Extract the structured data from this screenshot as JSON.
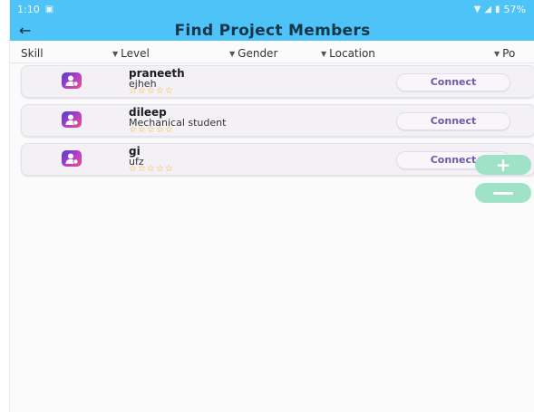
{
  "status_bar": {
    "time": "1:10",
    "battery": "57%"
  },
  "header": {
    "title": "Find Project Members",
    "back_icon": "arrow-left-icon"
  },
  "filters": [
    {
      "label": "Skill",
      "has_caret": false
    },
    {
      "label": "Level",
      "has_caret": true
    },
    {
      "label": "Gender",
      "has_caret": true
    },
    {
      "label": "Location",
      "has_caret": true
    },
    {
      "label": "Po",
      "has_caret": true
    }
  ],
  "members": [
    {
      "name": "praneeth",
      "subtitle": "ejheh",
      "stars": "☆☆☆☆☆",
      "button": "Connect"
    },
    {
      "name": "dileep",
      "subtitle": "Mechanical student",
      "stars": "☆☆☆☆☆",
      "button": "Connect"
    },
    {
      "name": "gi",
      "subtitle": "ufz",
      "stars": "☆☆☆☆☆",
      "button": "Connect"
    }
  ],
  "fab": {
    "plus_label": "+",
    "plus_icon": "plus-icon",
    "minus_icon": "minus-icon"
  },
  "colors": {
    "accent": "#4dc3f7",
    "fab": "#9fe2c8",
    "connect_text": "#6f5aa8",
    "star": "#f5b21b"
  }
}
